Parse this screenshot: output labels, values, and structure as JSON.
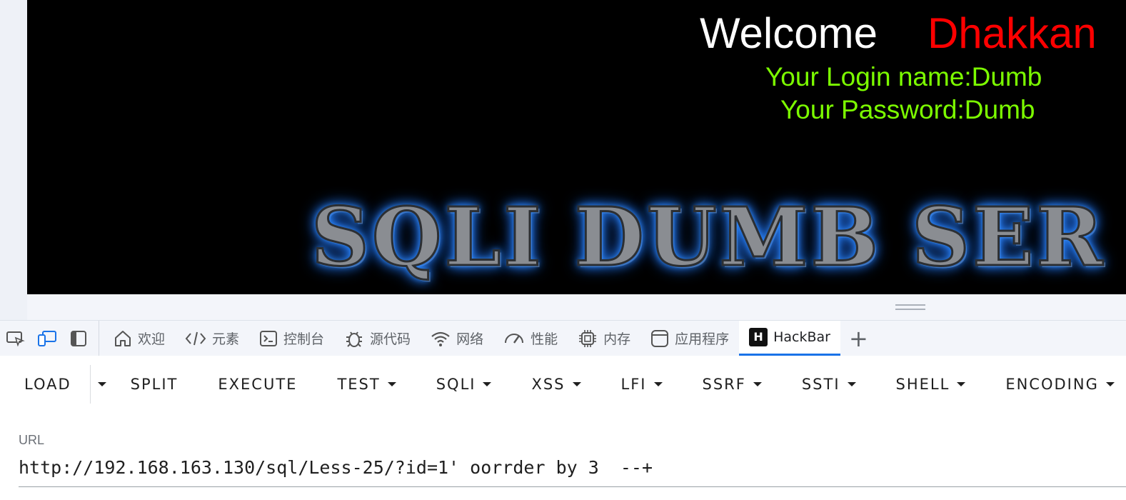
{
  "page": {
    "welcome_text": "Welcome",
    "username_text": "Dhakkan",
    "login_line": "Your Login name:Dumb",
    "password_line": "Your Password:Dumb",
    "banner_text": "SQLI DUMB SER"
  },
  "devtools": {
    "tabs": [
      {
        "label": "欢迎",
        "icon": "home-icon"
      },
      {
        "label": "元素",
        "icon": "code-icon"
      },
      {
        "label": "控制台",
        "icon": "console-icon"
      },
      {
        "label": "源代码",
        "icon": "bug-icon"
      },
      {
        "label": "网络",
        "icon": "wifi-icon"
      },
      {
        "label": "性能",
        "icon": "gauge-icon"
      },
      {
        "label": "内存",
        "icon": "chip-icon"
      },
      {
        "label": "应用程序",
        "icon": "app-window-icon"
      },
      {
        "label": "HackBar",
        "icon": "hackbar-logo-icon",
        "active": true
      }
    ],
    "hackbar_logo_letter": "H",
    "add_tab_glyph": "+"
  },
  "hackbar": {
    "buttons": {
      "load": "LOAD",
      "split": "SPLIT",
      "execute": "EXECUTE",
      "test": "TEST",
      "sqli": "SQLI",
      "xss": "XSS",
      "lfi": "LFI",
      "ssrf": "SSRF",
      "ssti": "SSTI",
      "shell": "SHELL",
      "encoding": "ENCODING"
    },
    "url_label": "URL",
    "url_value": "http://192.168.163.130/sql/Less-25/?id=1' oorrder by 3  --+"
  },
  "colors": {
    "welcome": "#ffffff",
    "username": "#ff0000",
    "login_info": "#7cfc00",
    "accent": "#1a73e8"
  }
}
